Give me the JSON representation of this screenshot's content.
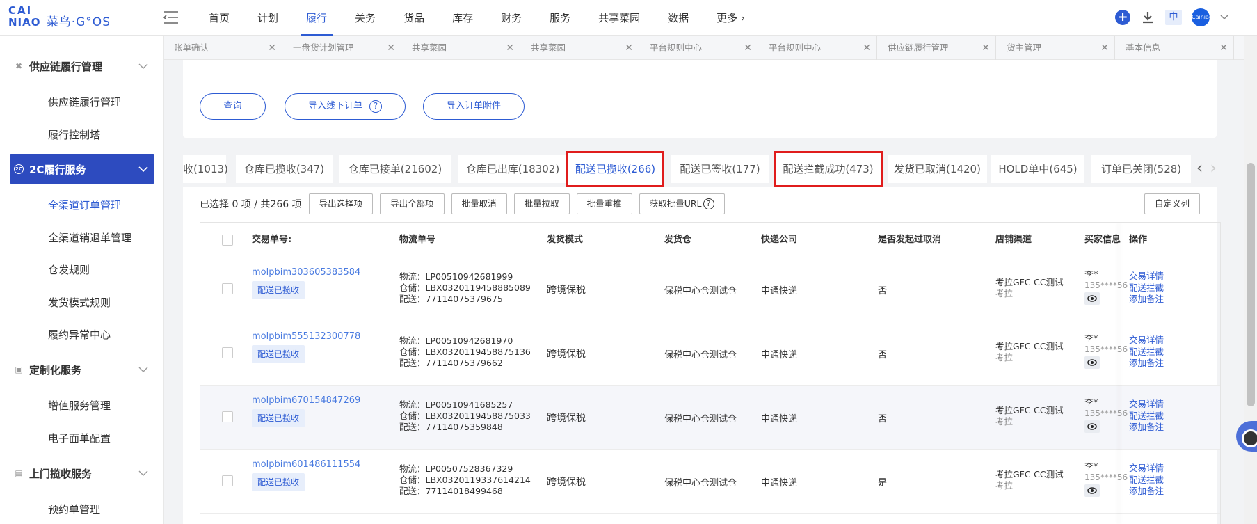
{
  "brand": {
    "line1": "CAI",
    "line2": "NIAO",
    "suffix": "菜鸟·G°OS"
  },
  "nav": [
    "首页",
    "计划",
    "履行",
    "关务",
    "货品",
    "库存",
    "财务",
    "服务",
    "共享菜园",
    "数据",
    "更多"
  ],
  "topright": {
    "lang": "中",
    "avatar": "Cainiao"
  },
  "sidebar": {
    "groups": [
      {
        "label": "供应链履行管理",
        "icon": "tools-icon"
      },
      {
        "label": "2C履行服务",
        "icon": "2c-icon",
        "badge": "2C"
      },
      {
        "label": "定制化服务",
        "icon": "custom-icon"
      },
      {
        "label": "上门揽收服务",
        "icon": "pickup-icon"
      }
    ],
    "items": [
      "供应链履行管理",
      "履行控制塔",
      "全渠道订单管理",
      "全渠道销退单管理",
      "仓发规则",
      "发货模式规则",
      "履约异常中心",
      "增值服务管理",
      "电子面单配置",
      "预约单管理"
    ]
  },
  "page_tabs": [
    "账单确认",
    "一盘货计划管理",
    "共享菜园",
    "共享菜园",
    "平台规则中心",
    "平台规则中心",
    "供应链履行管理",
    "货主管理",
    "基本信息"
  ],
  "actions": {
    "query": "查询",
    "import_offline": "导入线下订单",
    "import_attach": "导入订单附件"
  },
  "status_tabs": [
    "收(1013)",
    "仓库已揽收(347)",
    "仓库已接单(21602)",
    "仓库已出库(18302)",
    "配送已揽收(266)",
    "配送已签收(177)",
    "配送拦截成功(473)",
    "发货已取消(1420)",
    "HOLD单中(645)",
    "订单已关闭(528)"
  ],
  "toolbar": {
    "selected": "已选择 0 项 / 共266 项",
    "buttons": [
      "导出选择项",
      "导出全部项",
      "批量取消",
      "批量拉取",
      "批量重推",
      "获取批量URL"
    ],
    "custom_cols": "自定义列"
  },
  "table": {
    "headers": [
      "交易单号:",
      "物流单号",
      "发货模式",
      "发货仓",
      "快递公司",
      "是否发起过取消",
      "店铺渠道",
      "买家信息",
      "操作"
    ],
    "rows": [
      {
        "order": "molpbim303605383584",
        "status": "配送已揽收",
        "wl": "物流：LP00510942681999",
        "ck": "仓储：LBX0320119458885089",
        "ps": "配送：77114075379675",
        "mode": "跨境保税",
        "wh": "保税中心仓测试仓",
        "courier": "中通快递",
        "cancel": "否",
        "store": "考拉GFC-CC测试",
        "store2": "考拉",
        "buyer": "李*",
        "phone": "135****56"
      },
      {
        "order": "molpbim555132300778",
        "status": "配送已揽收",
        "wl": "物流：LP00510942681970",
        "ck": "仓储：LBX0320119458875136",
        "ps": "配送：77114075379662",
        "mode": "跨境保税",
        "wh": "保税中心仓测试仓",
        "courier": "中通快递",
        "cancel": "否",
        "store": "考拉GFC-CC测试",
        "store2": "考拉",
        "buyer": "李*",
        "phone": "135****56"
      },
      {
        "order": "molpbim670154847269",
        "status": "配送已揽收",
        "wl": "物流：LP00510941685257",
        "ck": "仓储：LBX0320119458875033",
        "ps": "配送：77114075359848",
        "mode": "跨境保税",
        "wh": "保税中心仓测试仓",
        "courier": "中通快递",
        "cancel": "否",
        "store": "考拉GFC-CC测试",
        "store2": "考拉",
        "buyer": "李*",
        "phone": "135****56"
      },
      {
        "order": "molpbim601486111554",
        "status": "配送已揽收",
        "wl": "物流：LP00507528367329",
        "ck": "仓储：LBX0320119337614214",
        "ps": "配送：77114018499468",
        "mode": "跨境保税",
        "wh": "保税中心仓测试仓",
        "courier": "中通快递",
        "cancel": "是",
        "store": "考拉GFC-CC测试",
        "store2": "考拉",
        "buyer": "李*",
        "phone": "135****56"
      }
    ],
    "ops": [
      "交易详情",
      "配送拦截",
      "添加备注"
    ]
  },
  "colors": {
    "brand": "#2d5bd3",
    "highlight_box": "#e01c1c"
  }
}
